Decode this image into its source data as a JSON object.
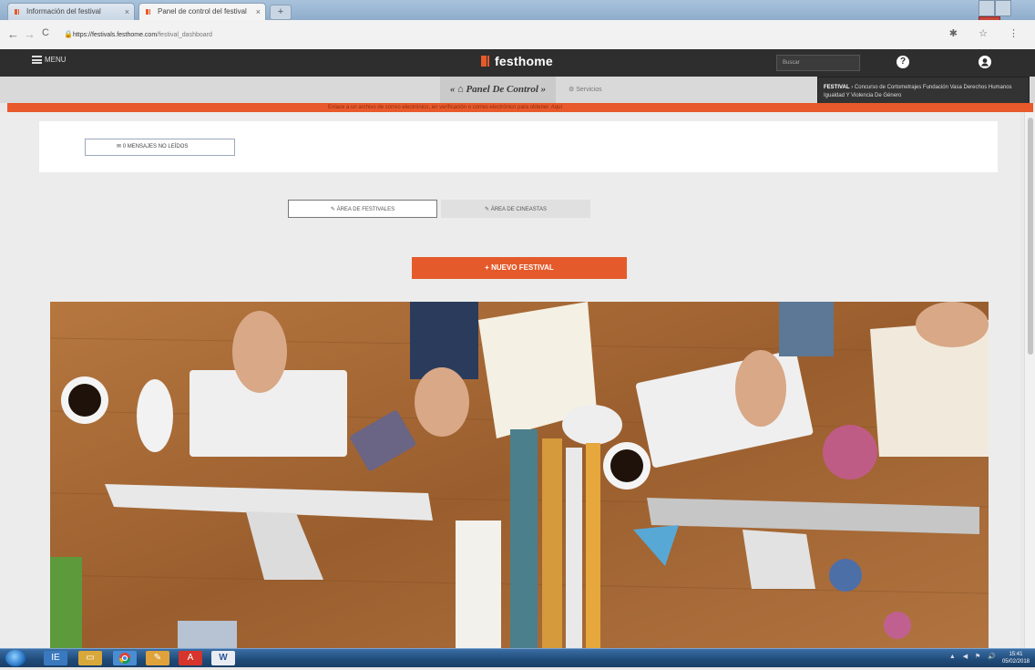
{
  "browser": {
    "tabs": [
      {
        "title": "Información del festival"
      },
      {
        "title": "Panel de control del festival"
      }
    ],
    "new_tab_symbol": "+",
    "url_host": "https://festivals.festhome.com",
    "url_path": "/festival_dashboard",
    "nav": {
      "back": "←",
      "forward": "→",
      "reload": "C"
    },
    "right_icons": "✱ ☆ ⋮"
  },
  "header": {
    "menu_label": "MENU",
    "logo_text": "festhome",
    "search_value": "Buscar",
    "help_icon": "?",
    "user_icon": "account-icon",
    "colors": {
      "bar": "#2e2e2e",
      "accent": "#e85a2c"
    }
  },
  "subnav": {
    "prefix": "«",
    "panel_label": "Panel De Control",
    "suffix": "»",
    "services_label": "Servicios"
  },
  "festival_dropdown": {
    "tag": "FESTIVAL",
    "text": "› Concurso de Cortometrajes Fundación Vasa Derechos Humanos Igualdad Y Violencia De Género"
  },
  "notice": {
    "text": "Enlace a un archivo de correo electrónico, en verificación o correo electrónico para obtener. Aquí"
  },
  "messages": {
    "button_label": "0 MENSAJES NO LEÍDOS"
  },
  "areas": {
    "festivals_label": "ÁREA DE FESTIVALES",
    "filmmakers_label": "ÁREA DE CINEASTAS"
  },
  "new_festival": {
    "label": "+ NUEVO FESTIVAL"
  },
  "taskbar": {
    "apps": [
      "IE",
      "Explorer",
      "Chrome",
      "Paint",
      "PDF",
      "Word"
    ],
    "clock_time": "15:41",
    "clock_date": "05/02/2018"
  }
}
